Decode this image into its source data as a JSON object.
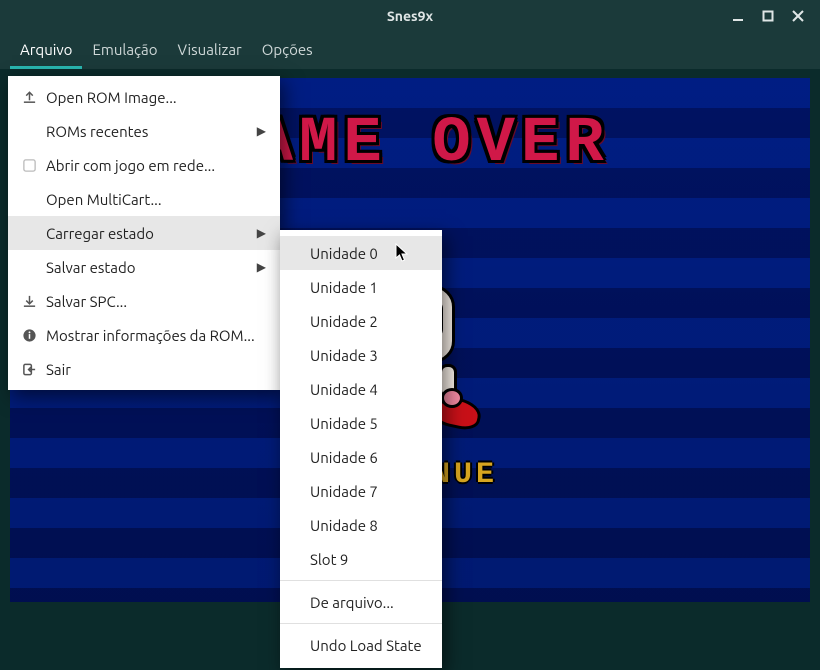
{
  "window": {
    "title": "Snes9x"
  },
  "menubar": {
    "items": [
      {
        "label": "Arquivo",
        "active": true
      },
      {
        "label": "Emulação",
        "active": false
      },
      {
        "label": "Visualizar",
        "active": false
      },
      {
        "label": "Opções",
        "active": false
      }
    ]
  },
  "game": {
    "overlay_top": "GAME OVER",
    "overlay_mid": "CONTINUE"
  },
  "file_menu": {
    "open_rom": "Open ROM Image...",
    "recent_roms": "ROMs recentes",
    "netplay": "Abrir com jogo em rede...",
    "multicart": "Open MultiCart...",
    "load_state": "Carregar estado",
    "save_state": "Salvar estado",
    "save_spc": "Salvar SPC...",
    "rom_info": "Mostrar informações da ROM...",
    "exit": "Sair"
  },
  "load_state_submenu": {
    "slots": [
      "Unidade 0",
      "Unidade 1",
      "Unidade 2",
      "Unidade 3",
      "Unidade 4",
      "Unidade 5",
      "Unidade 6",
      "Unidade 7",
      "Unidade 8",
      "Slot 9"
    ],
    "from_file": "De arquivo...",
    "undo": "Undo Load State"
  }
}
